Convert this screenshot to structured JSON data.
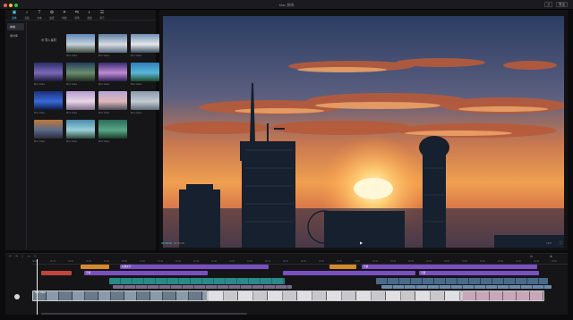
{
  "window": {
    "title": "Mac 剪映"
  },
  "titlebar_right": [
    "⎙",
    "导出"
  ],
  "toolbar": [
    {
      "icon": "media-icon",
      "glyph": "▣",
      "label": "媒体",
      "active": true
    },
    {
      "icon": "audio-icon",
      "glyph": "♪",
      "label": "音频"
    },
    {
      "icon": "text-icon",
      "glyph": "T",
      "label": "文本"
    },
    {
      "icon": "sticker-icon",
      "glyph": "✿",
      "label": "贴纸"
    },
    {
      "icon": "effects-icon",
      "glyph": "✦",
      "label": "特效"
    },
    {
      "icon": "transition-icon",
      "glyph": "⇆",
      "label": "转场"
    },
    {
      "icon": "filter-icon",
      "glyph": "◐",
      "label": "滤镜"
    },
    {
      "icon": "adjust-icon",
      "glyph": "☰",
      "label": "调节"
    }
  ],
  "subnav": [
    {
      "label": "本地",
      "selected": true
    },
    {
      "label": "素材库"
    }
  ],
  "media": {
    "import_label": "导入素材",
    "thumbs": [
      {
        "name": "Mov Video",
        "colors": [
          "#5b86b8",
          "#c9d3dc",
          "#3a4a3a"
        ]
      },
      {
        "name": "Mov Video",
        "colors": [
          "#5d7da0",
          "#d8dde3",
          "#5b6b7b"
        ]
      },
      {
        "name": "Mov Video",
        "colors": [
          "#6e8fb2",
          "#e4e7ea",
          "#40505e"
        ]
      },
      {
        "name": "Mov Video",
        "colors": [
          "#2b2f6a",
          "#7b68b8",
          "#1a1a3a"
        ]
      },
      {
        "name": "Mov Video",
        "colors": [
          "#243f5e",
          "#6a8d6e",
          "#1d2d20"
        ]
      },
      {
        "name": "Mov Video",
        "colors": [
          "#3a2b6e",
          "#c08bd6",
          "#2a2050"
        ]
      },
      {
        "name": "Mov Video",
        "colors": [
          "#2e7fb8",
          "#5ab6d8",
          "#1d4a2a"
        ]
      },
      {
        "name": "Mov Video",
        "colors": [
          "#1b2f7a",
          "#3a6ad8",
          "#0d1a40"
        ]
      },
      {
        "name": "Mov Video",
        "colors": [
          "#b49bd0",
          "#e8d6e6",
          "#7a6a8c"
        ]
      },
      {
        "name": "Mov Video",
        "colors": [
          "#b6a4d6",
          "#e0b8b8",
          "#4a4a5a"
        ]
      },
      {
        "name": "Mov Video",
        "colors": [
          "#8a9aac",
          "#c4ccd4",
          "#5e6a74"
        ]
      },
      {
        "name": "Mov Video",
        "colors": [
          "#c07838",
          "#5a6a8a",
          "#2a2a3a"
        ]
      },
      {
        "name": "Mov Video",
        "colors": [
          "#4a8aaa",
          "#9ad0d8",
          "#2a4a3a"
        ]
      },
      {
        "name": "Mov Video",
        "colors": [
          "#2a6a5a",
          "#58a888",
          "#1a3a2a"
        ]
      }
    ]
  },
  "player": {
    "current_time": "00:00:00",
    "total_time": "00:04:28",
    "ratio_label": "16:9",
    "accent": "#3fd2e0"
  },
  "timeline": {
    "tool_glyphs": [
      "↶",
      "↷",
      "⌶",
      "✂",
      "⛉"
    ],
    "ruler_ticks": [
      "00:00",
      "00:10",
      "00:20",
      "00:30",
      "00:40",
      "00:50",
      "01:00",
      "01:10",
      "01:20",
      "01:30",
      "01:40",
      "01:50",
      "02:00",
      "02:10",
      "02:20",
      "02:30",
      "02:40",
      "02:50",
      "03:00",
      "03:10",
      "03:20",
      "03:30",
      "03:40",
      "03:50",
      "04:00",
      "04:10",
      "04:20",
      "04:30",
      "04:40",
      "04:50"
    ],
    "track_colors": {
      "orange": "#d48a2a",
      "purple": "#7a4fc0",
      "red": "#c0453a",
      "teal": "#2a8a8a"
    },
    "text_clips": [
      "标题文字",
      "字幕",
      "字幕",
      "字幕"
    ],
    "video_caption": "Mov Video"
  }
}
